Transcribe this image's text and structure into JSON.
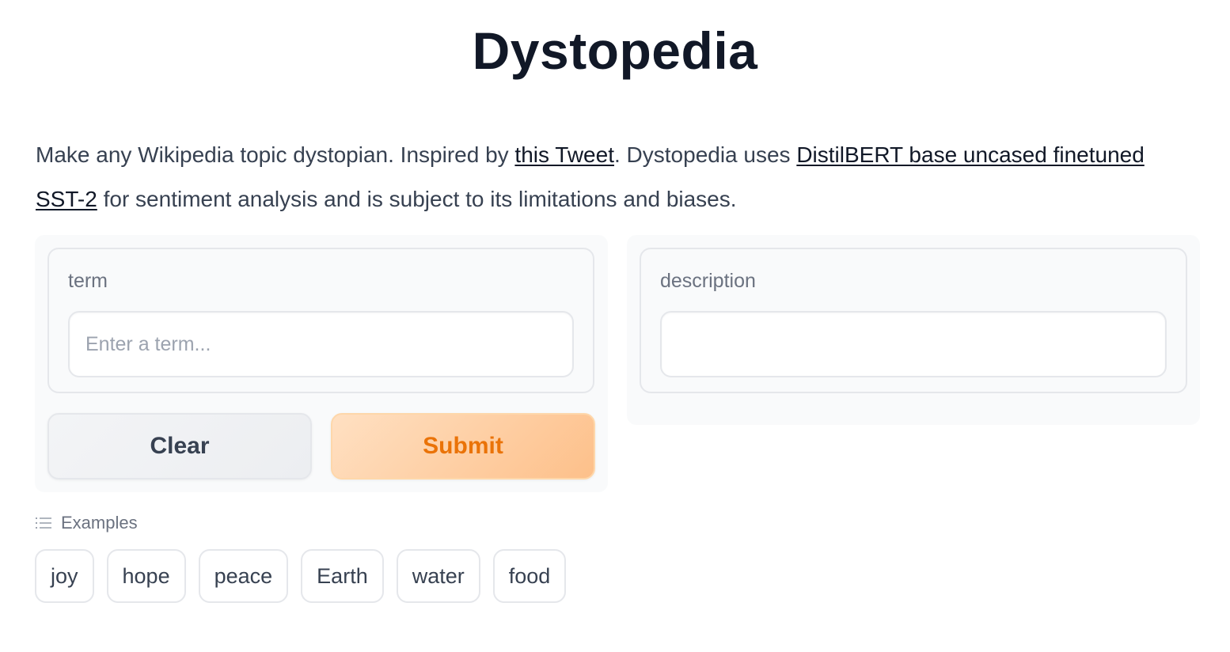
{
  "header": {
    "title": "Dystopedia"
  },
  "description": {
    "part1": "Make any Wikipedia topic dystopian. Inspired by ",
    "link1": "this Tweet",
    "part2": ". Dystopedia uses ",
    "link2": "DistilBERT base uncased finetuned SST-2",
    "part3": " for sentiment analysis and is subject to its limitations and biases."
  },
  "input": {
    "label": "term",
    "placeholder": "Enter a term...",
    "value": ""
  },
  "output": {
    "label": "description",
    "value": ""
  },
  "buttons": {
    "clear": "Clear",
    "submit": "Submit"
  },
  "examples": {
    "header": "Examples",
    "icon": "list-icon",
    "items": [
      "joy",
      "hope",
      "peace",
      "Earth",
      "water",
      "food"
    ]
  },
  "colors": {
    "accent": "#ea7308",
    "submit_bg": "#fdc08a",
    "panel_bg": "#f9fafb",
    "border": "#e5e7eb"
  }
}
